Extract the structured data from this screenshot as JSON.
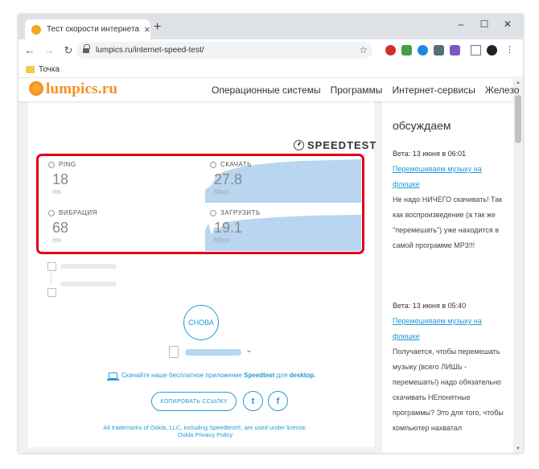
{
  "browser": {
    "tab_title": "Тест скорости интернета",
    "new_tab_glyph": "+",
    "url": "lumpics.ru/internet-speed-test/",
    "bookmark": "Точка"
  },
  "site": {
    "logo": "lumpics.ru",
    "nav": [
      "Операционные системы",
      "Программы",
      "Интернет-сервисы",
      "Железо"
    ]
  },
  "speedtest": {
    "brand": "SPEEDTEST",
    "metrics": {
      "ping": {
        "label": "PING",
        "value": "18",
        "unit": "ms"
      },
      "jitter": {
        "label": "ВИБРАЦИЯ",
        "value": "68",
        "unit": "ms"
      },
      "download": {
        "label": "СКАЧАТЬ",
        "value": "27.8",
        "unit": "Mbps"
      },
      "upload": {
        "label": "ЗАГРУЗИТЬ",
        "value": "19.1",
        "unit": "Mbps"
      }
    },
    "again_button": "СНОВА",
    "app_text_prefix": "Скачайте наше бесплатное приложение",
    "app_brand": "Speedtest",
    "app_text_mid": "для",
    "app_platform": "desktop.",
    "copy_link_button": "КОПИРОВАТЬ ССЫЛКУ",
    "trademark_line1": "All trademarks of Ookla, LLC, including Speedtest®, are used under license.",
    "trademark_line2": "Ookla Privacy Policy"
  },
  "sidebar": {
    "title": "обсуждаем",
    "posts": [
      {
        "date": "Вета: 13 июня в 06:01",
        "link": "Перемешиваем музыку на флешке",
        "text": "Не надо НИЧЕГО скачивать! Так как воспроизведение (а так же \"перемешать\") уже находится в самой программе MP3!!!"
      },
      {
        "date": "Вета: 13 июня в 05:40",
        "link": "Перемешиваем музыку на флешке",
        "text": "Получается, чтобы перемешать музыку (всего ЛИШЬ - перемешать!) надо обязательно скачивать НЕпонятные программы? Это для того, чтобы компьютер нахватал"
      }
    ]
  },
  "colors": {
    "accent": "#1f9ad6",
    "highlight": "#e0001b",
    "graph": "#b8d6ef",
    "logo": "#f7931e"
  }
}
